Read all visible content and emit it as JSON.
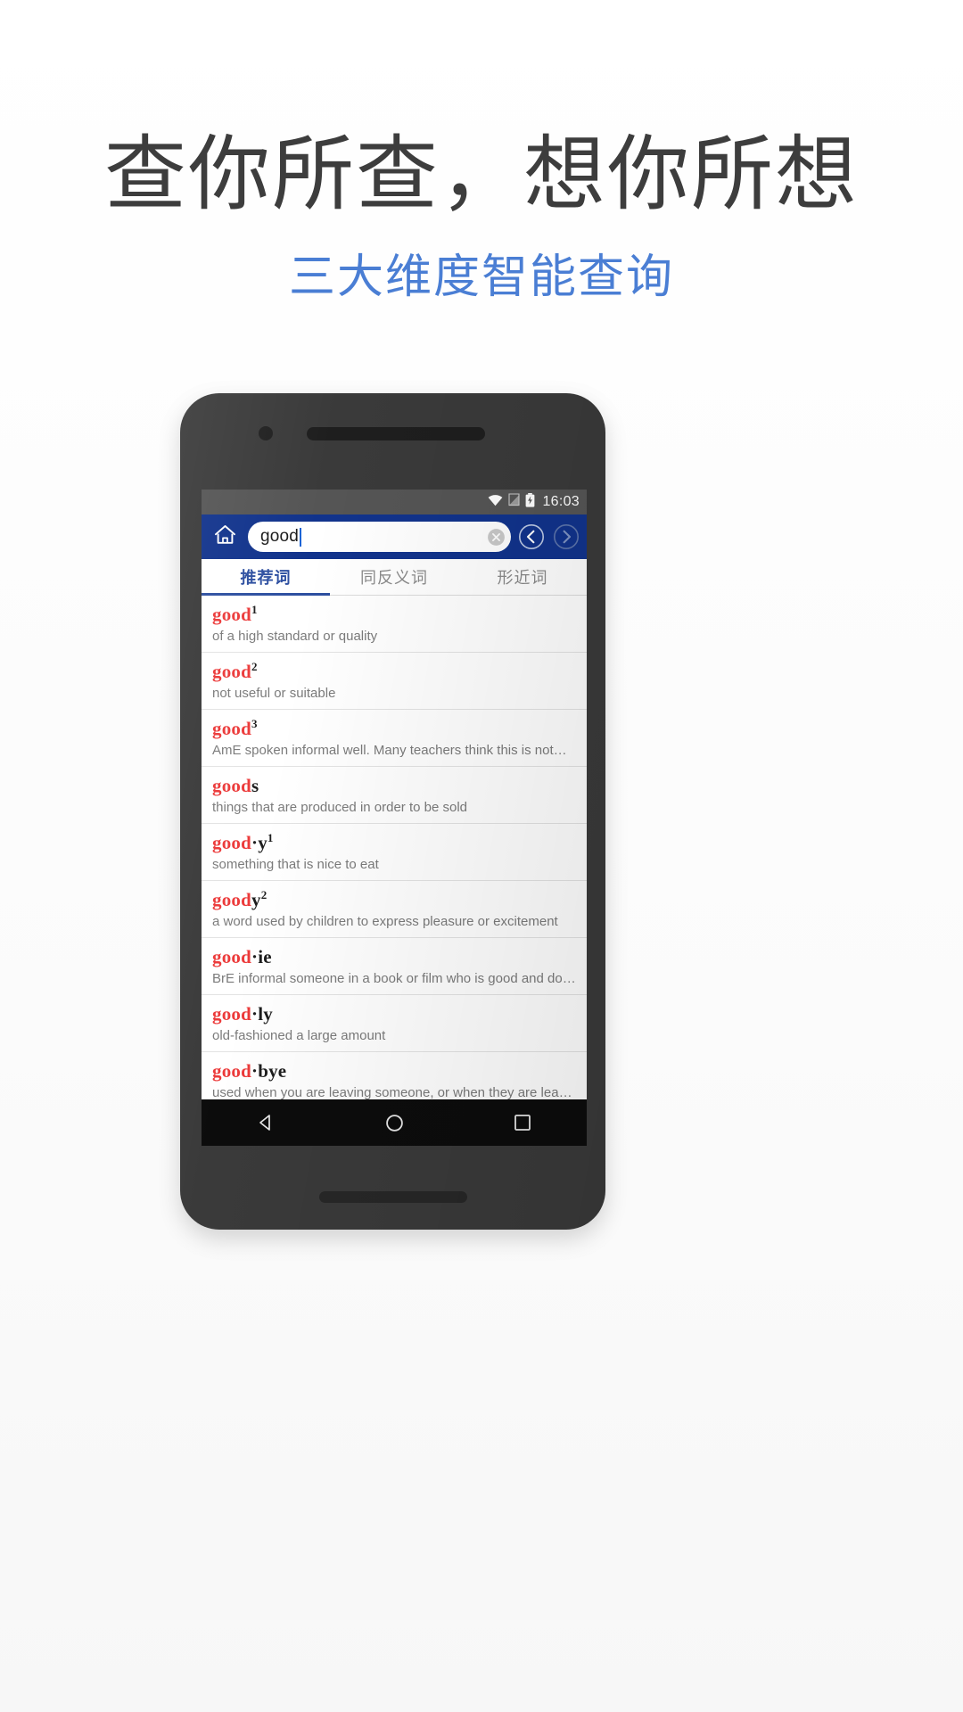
{
  "promo": {
    "headline": "查你所查，想你所想",
    "subhead": "三大维度智能查询",
    "headline_color": "#3d3d3d",
    "subhead_color": "#4a7ed4"
  },
  "phone": {
    "statusbar": {
      "time": "16:03",
      "icons": [
        "wifi-icon",
        "no-sim-icon",
        "battery-charging-icon"
      ]
    },
    "toolbar": {
      "home_icon": "home-icon",
      "search_value": "good",
      "search_placeholder": "",
      "clear_icon": "clear-circle-icon",
      "prev_icon": "chevron-left-circle-icon",
      "next_icon": "chevron-right-circle-icon",
      "background": "#11338c"
    },
    "tabs": [
      {
        "label": "推荐词",
        "active": true
      },
      {
        "label": "同反义词",
        "active": false
      },
      {
        "label": "形近词",
        "active": false
      }
    ],
    "accent": "#2d4fa0",
    "highlight_color": "#ec3a3a",
    "results": [
      {
        "match": "good",
        "rest": "",
        "sup": "1",
        "definition": "of a high standard or quality"
      },
      {
        "match": "good",
        "rest": "",
        "sup": "2",
        "definition": "not useful or suitable"
      },
      {
        "match": "good",
        "rest": "",
        "sup": "3",
        "definition": "AmE  spoken informal well. Many teachers think this is not…"
      },
      {
        "match": "good",
        "rest": "s",
        "sup": "",
        "definition": "things that are produced in order to be sold"
      },
      {
        "match": "good",
        "rest": "·y",
        "sup": "1",
        "definition": "something that is nice to eat"
      },
      {
        "match": "good",
        "rest": "y",
        "sup": "2",
        "definition": "a word used by children to express pleasure or excitement"
      },
      {
        "match": "good",
        "rest": "·ie",
        "sup": "",
        "definition": "BrE  informal someone in a book or film who is good and do…"
      },
      {
        "match": "good",
        "rest": "·ly",
        "sup": "",
        "definition": "old-fashioned a large amount"
      },
      {
        "match": "good",
        "rest": "·bye",
        "sup": "",
        "definition": "used when you are leaving someone, or when they are leaving"
      }
    ],
    "navbar": [
      {
        "icon": "back-triangle-icon"
      },
      {
        "icon": "home-circle-icon"
      },
      {
        "icon": "recents-square-icon"
      }
    ]
  }
}
